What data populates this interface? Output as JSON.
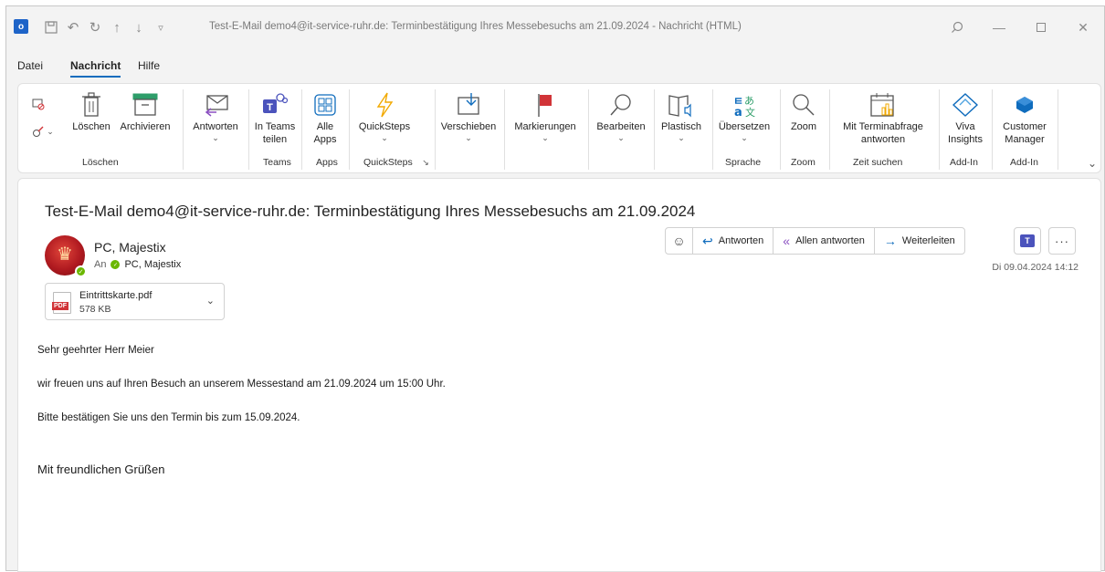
{
  "titlebar": {
    "title": "Test-E-Mail demo4@it-service-ruhr.de: Terminbestätigung Ihres Messebesuchs am 21.09.2024  -  Nachricht (HTML)"
  },
  "menu": {
    "tabs": [
      {
        "label": "Datei"
      },
      {
        "label": "Nachricht"
      },
      {
        "label": "Hilfe"
      }
    ]
  },
  "ribbon": {
    "loeschen": {
      "label": "Löschen"
    },
    "archivieren": {
      "label": "Archivieren"
    },
    "antworten": {
      "label": "Antworten"
    },
    "in_teams": {
      "label1": "In Teams",
      "label2": "teilen"
    },
    "alle_apps": {
      "label1": "Alle",
      "label2": "Apps"
    },
    "quicksteps": {
      "label": "QuickSteps"
    },
    "verschieben": {
      "label": "Verschieben"
    },
    "markierungen": {
      "label": "Markierungen"
    },
    "bearbeiten": {
      "label": "Bearbeiten"
    },
    "plastisch": {
      "label": "Plastisch"
    },
    "uebersetzen": {
      "label": "Übersetzen"
    },
    "zoom": {
      "label": "Zoom"
    },
    "terminabfrage": {
      "label1": "Mit Terminabfrage",
      "label2": "antworten"
    },
    "viva": {
      "label1": "Viva",
      "label2": "Insights"
    },
    "customer": {
      "label1": "Customer",
      "label2": "Manager"
    },
    "groups": {
      "loeschen": "Löschen",
      "teams": "Teams",
      "apps": "Apps",
      "quicksteps": "QuickSteps",
      "sprache": "Sprache",
      "zoom": "Zoom",
      "zeit_suchen": "Zeit suchen",
      "addin1": "Add-In",
      "addin2": "Add-In"
    }
  },
  "message": {
    "subject": "Test-E-Mail demo4@it-service-ruhr.de: Terminbestätigung Ihres Messebesuchs am 21.09.2024",
    "sender": "PC, Majestix",
    "to_label": "An",
    "to_name": "PC, Majestix",
    "date": "Di 09.04.2024 14:12",
    "actions": {
      "reply": "Antworten",
      "reply_all": "Allen antworten",
      "forward": "Weiterleiten"
    },
    "attachment": {
      "name": "Eintrittskarte.pdf",
      "size": "578 KB",
      "type_badge": "PDF"
    },
    "body": {
      "greeting": "Sehr geehrter Herr Meier",
      "line1": "wir freuen uns auf Ihren Besuch an unserem Messestand am 21.09.2024 um 15:00 Uhr.",
      "line2": "Bitte bestätigen Sie uns den Termin bis zum 15.09.2024.",
      "closing": "Mit freundlichen Grüßen"
    }
  },
  "colors": {
    "accent": "#0f6cbd",
    "flag_red": "#d13438",
    "presence_green": "#6bb700",
    "teams_purple": "#4b53bc"
  }
}
